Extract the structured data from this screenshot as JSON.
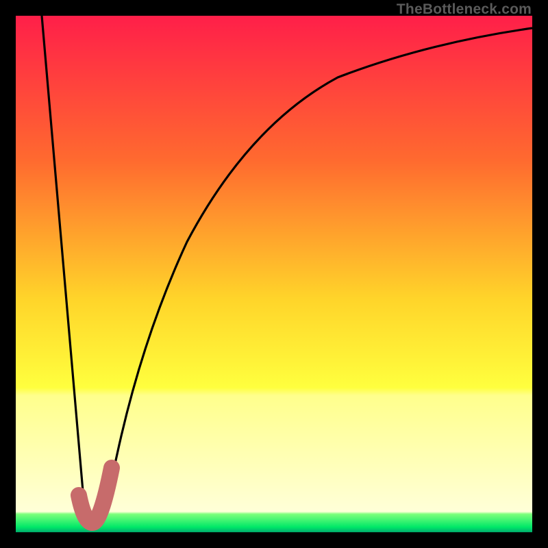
{
  "watermark": "TheBottleneck.com",
  "chart_data": {
    "type": "line",
    "title": "",
    "xlabel": "",
    "ylabel": "",
    "xlim": [
      0,
      100
    ],
    "ylim": [
      0,
      100
    ],
    "gradient_stops": [
      {
        "offset": 0,
        "color": "#ff1f49"
      },
      {
        "offset": 0.28,
        "color": "#ff6a2f"
      },
      {
        "offset": 0.55,
        "color": "#ffd52a"
      },
      {
        "offset": 0.72,
        "color": "#ffff3e"
      },
      {
        "offset": 0.735,
        "color": "#ffff8c"
      },
      {
        "offset": 0.96,
        "color": "#ffffd8"
      },
      {
        "offset": 0.965,
        "color": "#7bff7b"
      },
      {
        "offset": 0.99,
        "color": "#00e868"
      },
      {
        "offset": 0.996,
        "color": "#00c46c"
      },
      {
        "offset": 1.0,
        "color": "#00a868"
      }
    ],
    "series": [
      {
        "name": "bottleneck-curve",
        "x": [
          5,
          10,
          13,
          15,
          17,
          19,
          21,
          25,
          30,
          35,
          40,
          50,
          60,
          70,
          80,
          90,
          100
        ],
        "y": [
          100,
          45,
          8,
          2,
          3,
          6,
          15,
          35,
          55,
          68,
          76,
          86,
          91,
          94,
          96,
          97.5,
          98.5
        ]
      },
      {
        "name": "marker-tick",
        "x": [
          12,
          14,
          17,
          18
        ],
        "y": [
          6,
          2,
          3,
          12
        ]
      }
    ],
    "marker_color": "#c76b6b",
    "curve_color": "#000000"
  }
}
